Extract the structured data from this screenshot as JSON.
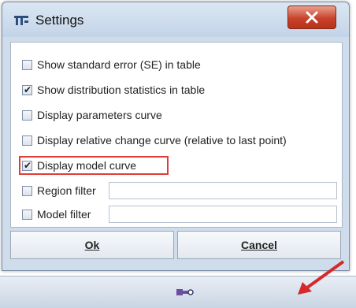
{
  "window": {
    "title": "Settings",
    "close_label": "X",
    "app_icon": "settings-app-icon"
  },
  "options": [
    {
      "label": "Show standard error (SE) in table",
      "checked": false
    },
    {
      "label": "Show distribution statistics in table",
      "checked": true
    },
    {
      "label": "Display parameters curve",
      "checked": false
    },
    {
      "label": "Display relative change curve (relative to last point)",
      "checked": false
    },
    {
      "label": "Display model curve",
      "checked": true
    }
  ],
  "filters": [
    {
      "label": "Region filter",
      "checked": false,
      "value": ""
    },
    {
      "label": "Model filter",
      "checked": false,
      "value": ""
    }
  ],
  "buttons": {
    "ok": "Ok",
    "cancel": "Cancel"
  },
  "colors": {
    "highlight": "#e03c3c",
    "arrow": "#d42a2a",
    "close_button": "#c8432b"
  },
  "bottom_bar": {
    "icon": "tool-icon"
  }
}
